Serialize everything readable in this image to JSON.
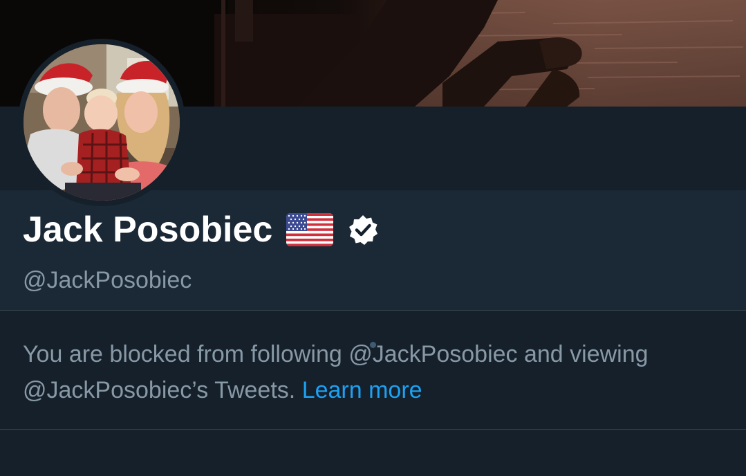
{
  "profile": {
    "display_name": "Jack Posobiec",
    "handle": "@JackPosobiec",
    "flag_icon": "us-flag-icon",
    "verified_icon": "verified-badge-icon"
  },
  "blocked_notice": {
    "text": "You are blocked from following @JackPosobiec and viewing @JackPosobiec’s Tweets.",
    "learn_more": "Learn more"
  },
  "colors": {
    "background": "#15202b",
    "name_section": "#1b2836",
    "text_primary": "#ffffff",
    "text_secondary": "#8899a6",
    "link": "#1da1f2",
    "divider": "#38444d"
  }
}
